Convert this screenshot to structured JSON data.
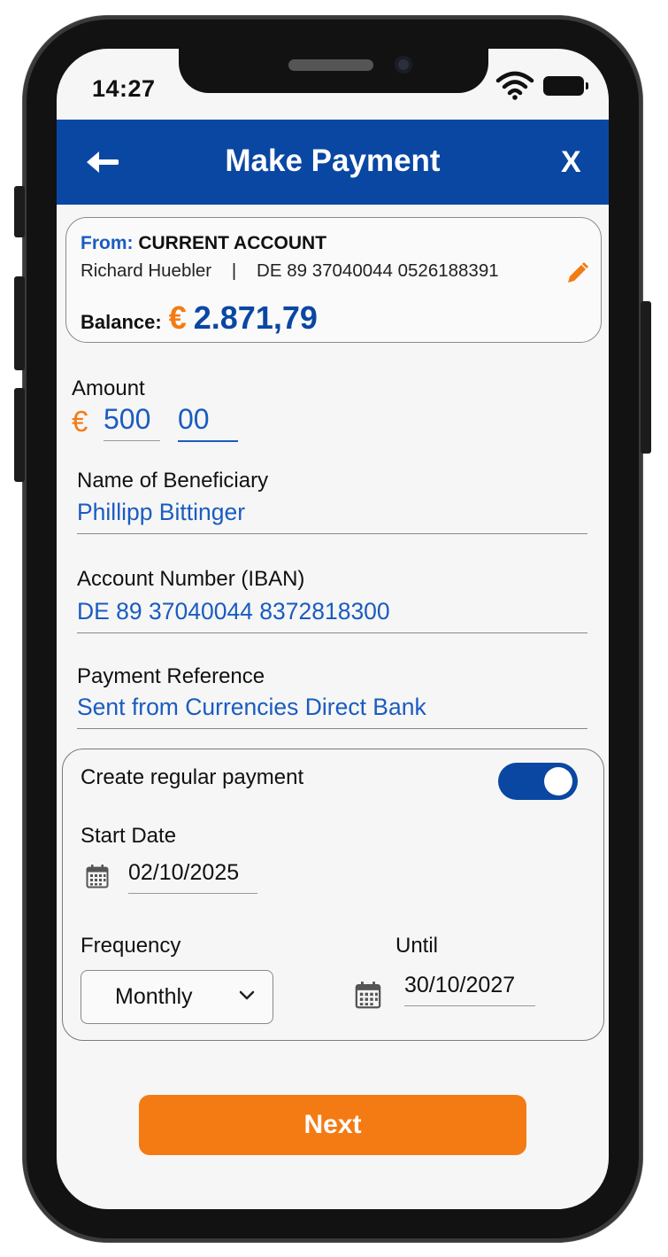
{
  "status_bar": {
    "time": "14:27"
  },
  "header": {
    "title": "Make Payment",
    "close_label": "X"
  },
  "from_account": {
    "from_label": "From:",
    "account_type": "CURRENT ACCOUNT",
    "owner": "Richard Huebler",
    "separator": "|",
    "iban": "DE 89 37040044 0526188391",
    "balance_label": "Balance:",
    "currency_symbol": "€",
    "balance": "2.871,79"
  },
  "amount": {
    "label": "Amount",
    "currency_symbol": "€",
    "integer": "500",
    "decimal": "00"
  },
  "beneficiary": {
    "label": "Name of Beneficiary",
    "value": "Phillipp Bittinger"
  },
  "account_number": {
    "label": "Account Number (IBAN)",
    "value": "DE 89 37040044 8372818300"
  },
  "reference": {
    "label": "Payment Reference",
    "value": "Sent from Currencies Direct Bank"
  },
  "regular_payment": {
    "label": "Create regular payment",
    "enabled": true,
    "start_date_label": "Start Date",
    "start_date": "02/10/2025",
    "frequency_label": "Frequency",
    "frequency": "Monthly",
    "until_label": "Until",
    "until_date": "30/10/2027"
  },
  "actions": {
    "next_label": "Next"
  },
  "colors": {
    "primary": "#0a47a3",
    "accent": "#f47b13",
    "link": "#1a5cc0"
  }
}
